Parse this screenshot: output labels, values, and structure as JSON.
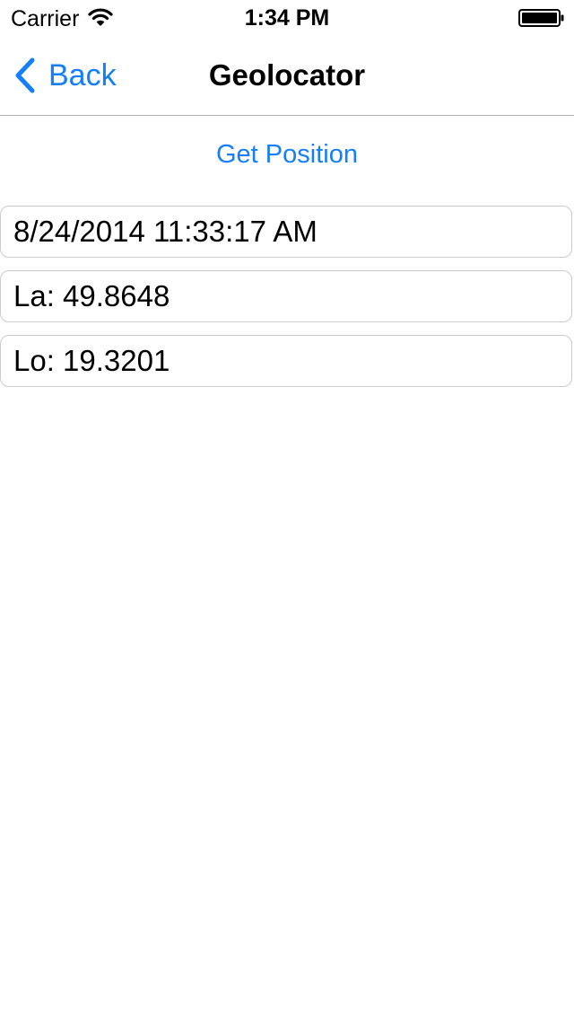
{
  "status_bar": {
    "carrier": "Carrier",
    "time": "1:34 PM",
    "wifi_icon": "wifi-icon",
    "battery_icon": "battery-icon"
  },
  "nav_bar": {
    "back_label": "Back",
    "back_icon": "chevron-left-icon",
    "title": "Geolocator"
  },
  "main": {
    "get_position_label": "Get Position",
    "fields": {
      "timestamp": "8/24/2014 11:33:17 AM",
      "latitude": "La: 49.8648",
      "longitude": "Lo: 19.3201"
    }
  },
  "colors": {
    "accent": "#157efb",
    "separator": "#b2b2b2",
    "field_border": "#cccccc"
  }
}
